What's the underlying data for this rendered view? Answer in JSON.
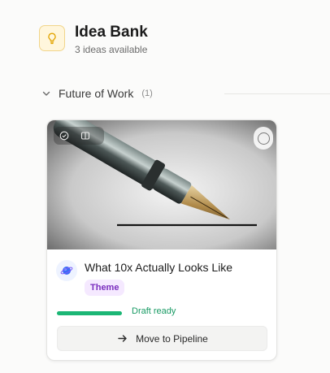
{
  "header": {
    "icon": "lightbulb-icon",
    "title": "Idea Bank",
    "subtitle": "3 ideas available"
  },
  "section": {
    "icon": "chevron-down-icon",
    "title": "Future of Work",
    "count": "(1)"
  },
  "card": {
    "image_alt": "fountain-pen-image",
    "toolbar_icons": [
      "check-circle-icon",
      "grid-icon"
    ],
    "select_icon": "select-circle-icon",
    "avatar_icon": "planet-icon",
    "title": "What 10x Actually Looks Like",
    "badge": "Theme",
    "progress_fraction": 1.0,
    "status": "Draft ready",
    "button_icon": "arrow-right-icon",
    "button_label": "Move to Pipeline"
  },
  "colors": {
    "accent_green": "#1bb675",
    "badge_purple": "#7b2fbf",
    "bulb_yellow": "#f5b700"
  }
}
